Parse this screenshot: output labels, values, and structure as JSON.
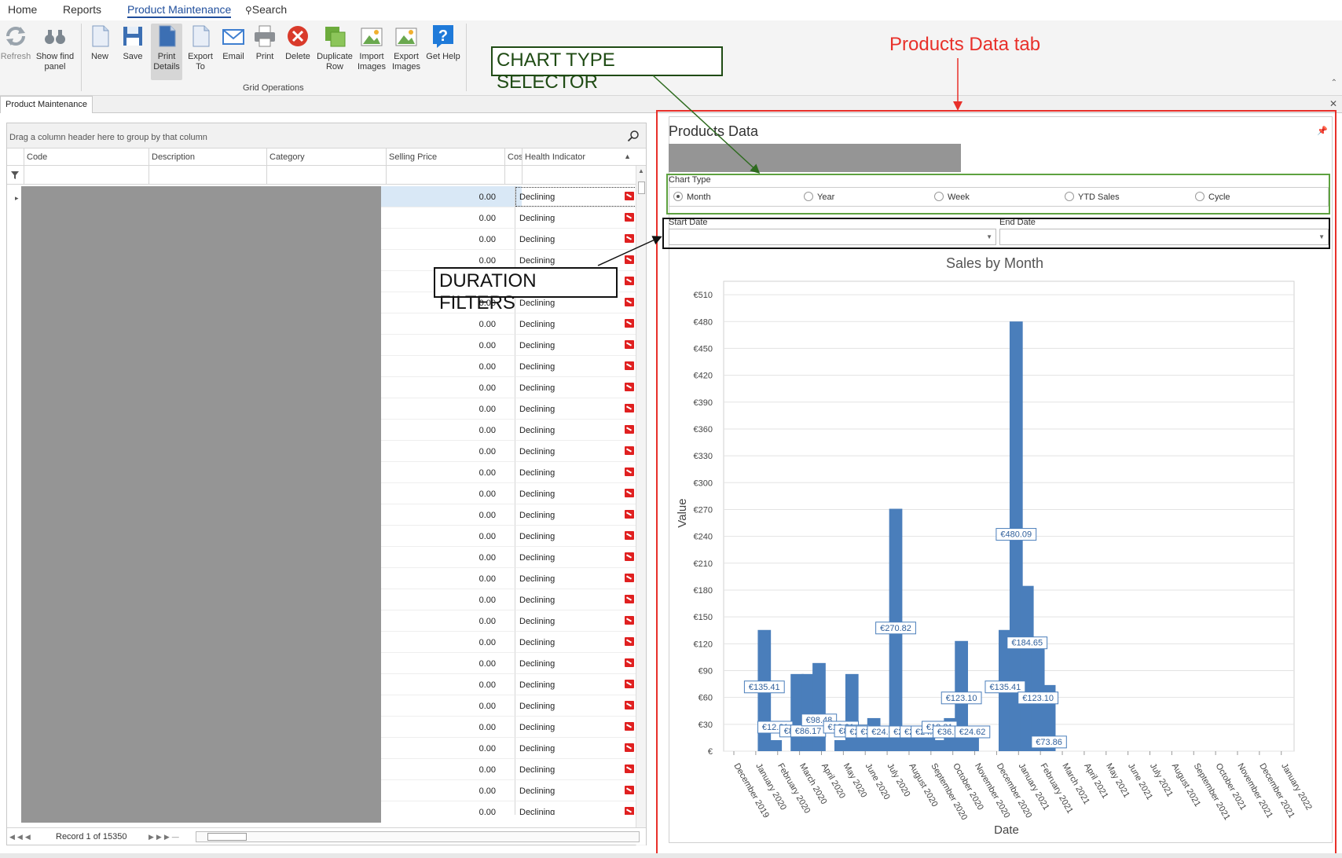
{
  "menu": {
    "items": [
      "Home",
      "Reports",
      "Product Maintenance",
      "Search"
    ],
    "active_index": 2
  },
  "ribbon": {
    "buttons": [
      {
        "label": "Refresh",
        "icon": "refresh-icon"
      },
      {
        "label": "Show find panel",
        "icon": "binoculars-icon"
      },
      {
        "label": "New",
        "icon": "new-document-icon"
      },
      {
        "label": "Save",
        "icon": "floppy-disk-icon"
      },
      {
        "label": "Print Details",
        "icon": "print-details-icon"
      },
      {
        "label": "Export To",
        "icon": "export-icon"
      },
      {
        "label": "Email",
        "icon": "envelope-icon"
      },
      {
        "label": "Print",
        "icon": "printer-icon"
      },
      {
        "label": "Delete",
        "icon": "delete-icon"
      },
      {
        "label": "Duplicate Row",
        "icon": "duplicate-icon"
      },
      {
        "label": "Import Images",
        "icon": "import-images-icon"
      },
      {
        "label": "Export Images",
        "icon": "export-images-icon"
      },
      {
        "label": "Get Help",
        "icon": "help-icon"
      }
    ],
    "group_label": "Grid Operations",
    "accent": "#2b77c9"
  },
  "doc_tab": "Product Maintenance",
  "grid": {
    "group_hint": "Drag a column header here to group by that column",
    "columns": [
      "Code",
      "Description",
      "Category",
      "Selling Price",
      "Cos",
      "Health Indicator"
    ],
    "row_price": "0.00",
    "row_health": "Declining",
    "row_count_visible": 30,
    "record_text": "Record 1 of 15350",
    "health_icon_color": "#e02020",
    "selected_row_color": "#d9e8f6"
  },
  "panel": {
    "title": "Products Data",
    "chart_type_label": "Chart Type",
    "chart_types": [
      "Month",
      "Year",
      "Week",
      "YTD Sales",
      "Cycle"
    ],
    "chart_type_selected": "Month",
    "start_date_label": "Start Date",
    "end_date_label": "End Date",
    "start_date_value": "",
    "end_date_value": ""
  },
  "annotations": {
    "panel_tab": "Products Data tab",
    "chart_selector": "CHART TYPE SELECTOR",
    "duration_filters": "DURATION FILTERS",
    "panel_color": "#e8302a",
    "selector_color": "#5ea240",
    "filters_color": "#111111"
  },
  "chart_data": {
    "type": "bar",
    "title": "Sales by Month",
    "xlabel": "Date",
    "ylabel": "Value",
    "ylim": [
      0,
      525
    ],
    "yticks": [
      0,
      30,
      60,
      90,
      120,
      150,
      180,
      210,
      240,
      270,
      300,
      330,
      360,
      390,
      420,
      450,
      480,
      510
    ],
    "ytick_labels": [
      "€",
      "€30",
      "€60",
      "€90",
      "€120",
      "€150",
      "€180",
      "€210",
      "€240",
      "€270",
      "€300",
      "€330",
      "€360",
      "€390",
      "€420",
      "€450",
      "€480",
      "€510"
    ],
    "x_tick_labels": [
      "December 2019",
      "January 2020",
      "February 2020",
      "March 2020",
      "April 2020",
      "May 2020",
      "June 2020",
      "July 2020",
      "August 2020",
      "September 2020",
      "October 2020",
      "November 2020",
      "December 2020",
      "January 2021",
      "February 2021",
      "March 2021",
      "April 2021",
      "May 2021",
      "June 2021",
      "July 2021",
      "August 2021",
      "September 2021",
      "October 2021",
      "November 2021",
      "December 2021",
      "January 2022"
    ],
    "bars": [
      {
        "x": 1.0,
        "value": 135.41,
        "label": "€135.41"
      },
      {
        "x": 1.5,
        "value": 12.31,
        "label": "€12.31"
      },
      {
        "x": 2.5,
        "value": 86.17,
        "label": "€86.17"
      },
      {
        "x": 3.0,
        "value": 86.17,
        "label": "€86.17"
      },
      {
        "x": 3.5,
        "value": 98.48,
        "label": "€98.48"
      },
      {
        "x": 4.5,
        "value": 12.31,
        "label": "€12.31"
      },
      {
        "x": 5.0,
        "value": 86.17,
        "label": "€86.17"
      },
      {
        "x": 5.5,
        "value": 24.62,
        "label": "€24.62"
      },
      {
        "x": 6.0,
        "value": 36.93,
        "label": "€36.93"
      },
      {
        "x": 6.5,
        "value": 24.62,
        "label": "€24.62"
      },
      {
        "x": 7.0,
        "value": 270.82,
        "label": "€270.82"
      },
      {
        "x": 7.5,
        "value": 24.62,
        "label": "€24.62"
      },
      {
        "x": 8.0,
        "value": 24.62,
        "label": "€24.62"
      },
      {
        "x": 8.5,
        "value": 24.62,
        "label": "€24.62"
      },
      {
        "x": 9.0,
        "value": 12.31,
        "label": "€12.31"
      },
      {
        "x": 9.5,
        "value": 36.93,
        "label": "€36.93"
      },
      {
        "x": 10.0,
        "value": 123.1,
        "label": "€123.10"
      },
      {
        "x": 10.5,
        "value": 24.62,
        "label": "€24.62"
      },
      {
        "x": 12.0,
        "value": 135.41,
        "label": "€135.41"
      },
      {
        "x": 12.5,
        "value": 480.09,
        "label": "€480.09"
      },
      {
        "x": 13.0,
        "value": 184.65,
        "label": "€184.65"
      },
      {
        "x": 13.5,
        "value": 123.1,
        "label": "€123.10"
      },
      {
        "x": 14.0,
        "value": 73.86,
        "label": "€73.86"
      }
    ],
    "bar_color": "#4a7ebb",
    "grid": true,
    "legend": "none"
  }
}
